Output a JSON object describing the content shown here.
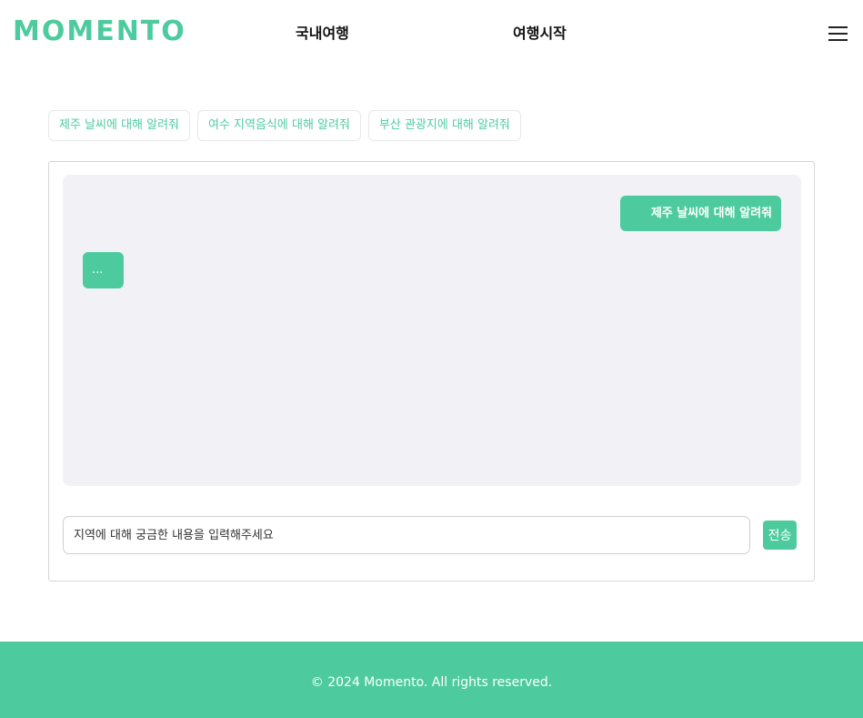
{
  "header": {
    "logo": "MOMENTO",
    "nav": [
      "국내여행",
      "여행시작"
    ],
    "menu_icon": "hamburger-menu-icon"
  },
  "suggestions": [
    "제주 날씨에 대해 알려줘",
    "여수 지역음식에 대해 알려줘",
    "부산 관광지에 대해 알려줘"
  ],
  "chat": {
    "user_message": "제주 날씨에 대해 알려줘",
    "bot_message": "...",
    "input_value": "",
    "input_placeholder": "지역에 대해 궁금한 내용을 입력해주세요",
    "send_label": "전송"
  },
  "footer": {
    "copyright": "© 2024 Momento. All rights reserved."
  },
  "colors": {
    "accent": "#4ecb9e",
    "chat_background": "#f1f1f6"
  }
}
